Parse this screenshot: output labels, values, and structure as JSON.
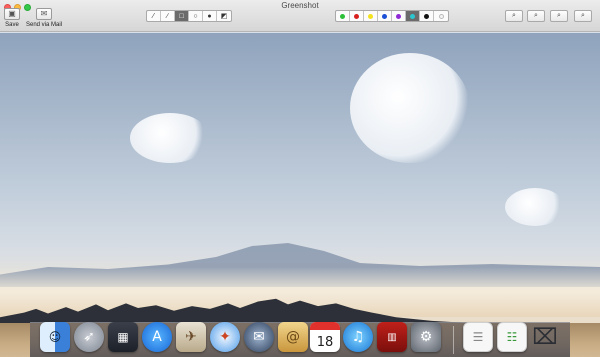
{
  "window": {
    "title": "Greenshot"
  },
  "toolbar": {
    "save_label": "Save",
    "send_mail_label": "Send via Mail",
    "colors": [
      "#2bbf3a",
      "#d7201d",
      "#f3e21f",
      "#1b4fd6",
      "#8f2ad6",
      "#2bc6cf",
      "#111111",
      "#f4f4f4"
    ],
    "selected_color": "#2bc6cf"
  },
  "dock": {
    "calendar_day": "18"
  }
}
